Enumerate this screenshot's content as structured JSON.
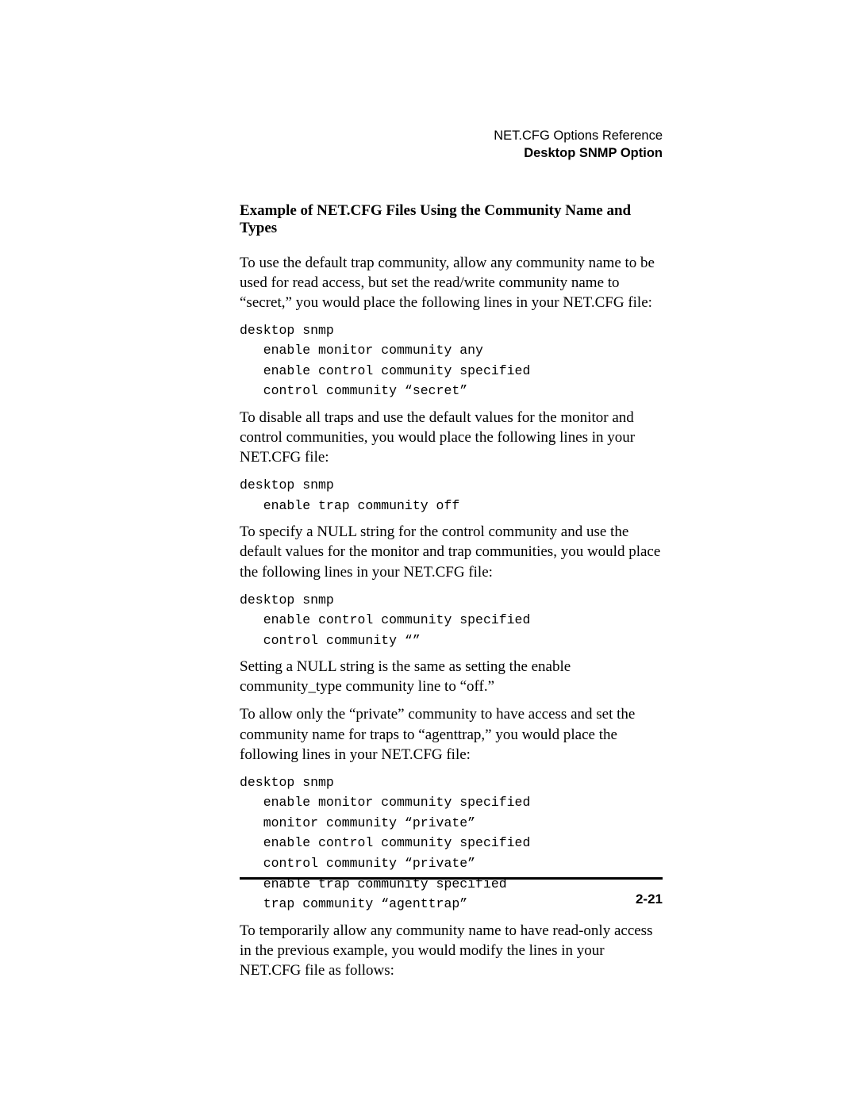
{
  "header": {
    "doc_title": "NET.CFG Options Reference",
    "section_title": "Desktop SNMP Option"
  },
  "content": {
    "heading": "Example of NET.CFG Files Using the Community Name and Types",
    "para1": "To use the default trap community, allow any community name to be used for read access, but set the read/write community name to “secret,” you would place the following lines in your NET.CFG file:",
    "code1": "desktop snmp\n   enable monitor community any\n   enable control community specified\n   control community “secret”",
    "para2": "To disable all traps and use the default values for the monitor and control communities, you would place the following lines in your NET.CFG file:",
    "code2": "desktop snmp\n   enable trap community off",
    "para3": "To specify a NULL string for the control community and use the default values for the monitor and trap communities, you would place the following lines in your NET.CFG file:",
    "code3": "desktop snmp\n   enable control community specified\n   control community “”",
    "para4": "Setting a NULL string is the same as setting the enable community_type community line to “off.”",
    "para5": "To allow only the “private” community to have access and set the community name for traps to “agenttrap,” you would place the following lines in your NET.CFG file:",
    "code4": "desktop snmp\n   enable monitor community specified\n   monitor community “private”\n   enable control community specified\n   control community “private”\n   enable trap community specified\n   trap community “agenttrap”",
    "para6": "To temporarily allow any community name to have read-only access in the previous example, you would modify the lines in your NET.CFG file as follows:"
  },
  "footer": {
    "page_number": "2-21"
  }
}
